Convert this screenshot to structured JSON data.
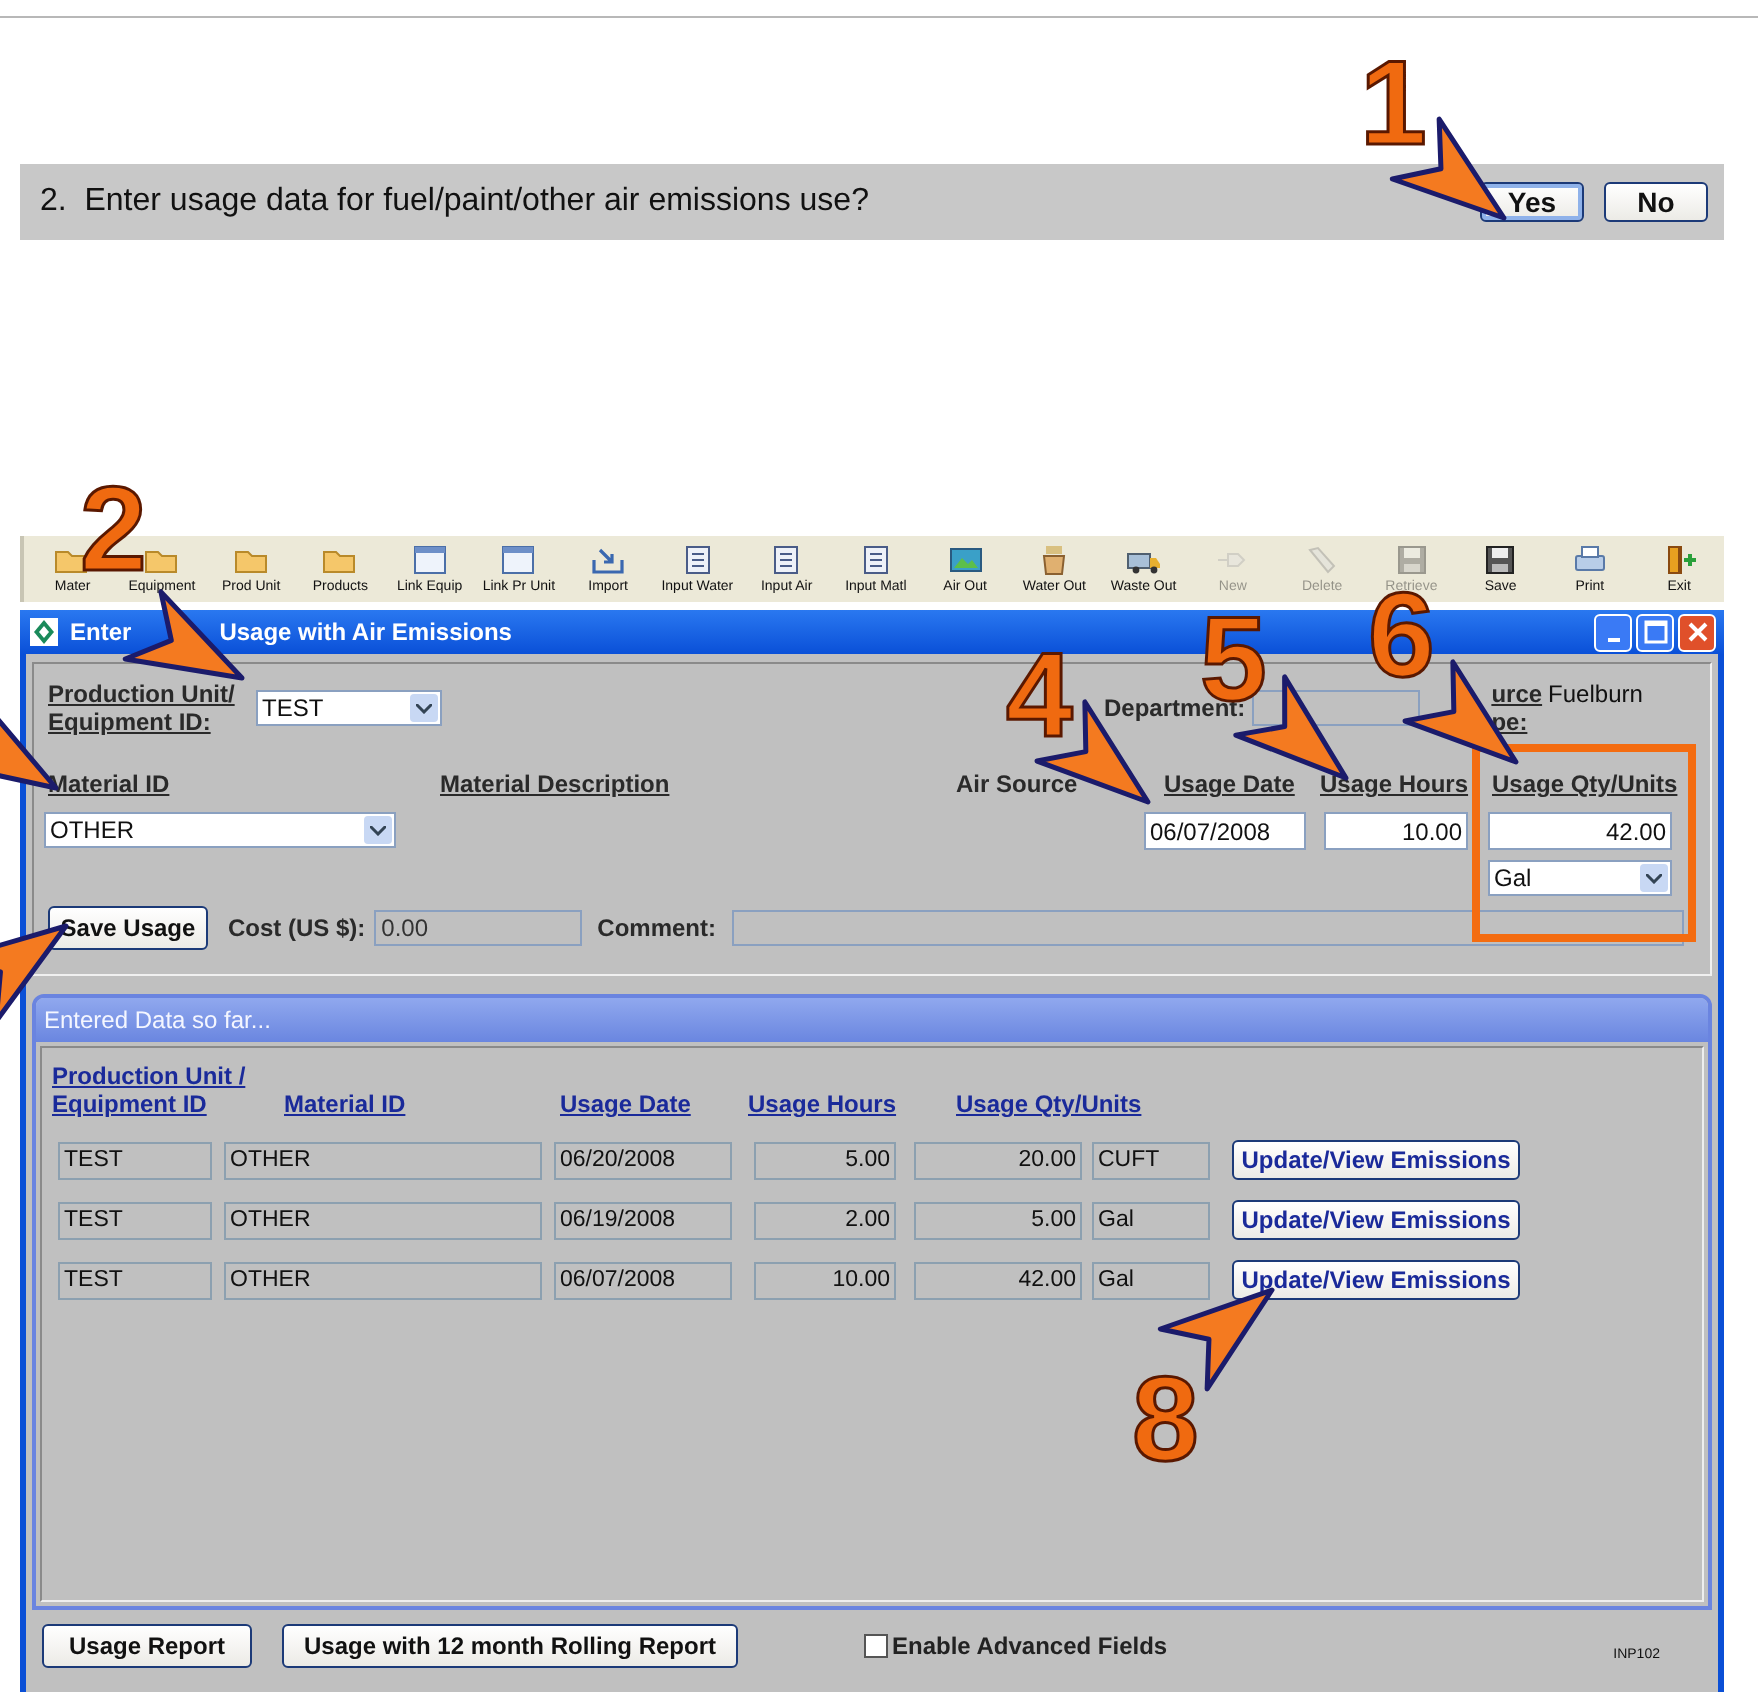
{
  "question": {
    "number": "2.",
    "text": "Enter usage data for fuel/paint/other air emissions use?",
    "buttons": [
      {
        "label": "Yes",
        "selected": true
      },
      {
        "label": "No",
        "selected": false
      }
    ]
  },
  "toolbar": [
    {
      "label": "Mater",
      "kind": "folder",
      "disabled": false
    },
    {
      "label": "Equipment",
      "kind": "folder",
      "disabled": false
    },
    {
      "label": "Prod Unit",
      "kind": "folder",
      "disabled": false
    },
    {
      "label": "Products",
      "kind": "folder",
      "disabled": false
    },
    {
      "label": "Link Equip",
      "kind": "window",
      "disabled": false
    },
    {
      "label": "Link Pr Unit",
      "kind": "window",
      "disabled": false
    },
    {
      "label": "Import",
      "kind": "import",
      "disabled": false
    },
    {
      "label": "Input Water",
      "kind": "document",
      "disabled": false
    },
    {
      "label": "Input Air",
      "kind": "document",
      "disabled": false
    },
    {
      "label": "Input Matl",
      "kind": "document",
      "disabled": false
    },
    {
      "label": "Air Out",
      "kind": "picture",
      "disabled": false
    },
    {
      "label": "Water Out",
      "kind": "bucket",
      "disabled": false
    },
    {
      "label": "Waste Out",
      "kind": "truck",
      "disabled": false
    },
    {
      "label": "New",
      "kind": "plug",
      "disabled": true
    },
    {
      "label": "Delete",
      "kind": "eraser",
      "disabled": true
    },
    {
      "label": "Retrieve",
      "kind": "floppy",
      "disabled": true
    },
    {
      "label": "Save",
      "kind": "floppy",
      "disabled": false
    },
    {
      "label": "Print",
      "kind": "printer",
      "disabled": false
    },
    {
      "label": "Exit",
      "kind": "exit",
      "disabled": false
    }
  ],
  "window": {
    "title_start": "Enter",
    "title_end": "Usage with Air Emissions"
  },
  "form": {
    "equipment_label_lines": [
      "Production Unit/",
      "Equipment ID:"
    ],
    "equipment_value": "TEST",
    "department_label": "Department:",
    "source_label_lines": [
      "urce",
      "pe:"
    ],
    "source_value": "Fuelburn",
    "headers": [
      "Material ID",
      "Material Description",
      "Air Source",
      "Usage Date",
      "Usage Hours",
      "Usage Qty/Units"
    ],
    "material_value": "OTHER",
    "usage_date": "06/07/2008",
    "usage_hours": "10.00",
    "usage_qty": "42.00",
    "unit_value": "Gal",
    "save_button": "Save Usage",
    "cost_label": "Cost (US $):",
    "cost_value": "0.00",
    "comment_label": "Comment:"
  },
  "entered_data": {
    "title": "Entered Data so far...",
    "columns": [
      "Production Unit / Equipment ID",
      "Material ID",
      "Usage Date",
      "Usage Hours",
      "Usage Qty/Units"
    ],
    "rows": [
      {
        "cells": [
          "TEST",
          "OTHER",
          "06/20/2008",
          "5.00",
          "20.00",
          "CUFT"
        ],
        "button": "Update/View Emissions"
      },
      {
        "cells": [
          "TEST",
          "OTHER",
          "06/19/2008",
          "2.00",
          "5.00",
          "Gal"
        ],
        "button": "Update/View Emissions"
      },
      {
        "cells": [
          "TEST",
          "OTHER",
          "06/07/2008",
          "10.00",
          "42.00",
          "Gal"
        ],
        "button": "Update/View Emissions"
      }
    ]
  },
  "footer": {
    "buttons": [
      "Usage Report",
      "Usage with 12 month Rolling Report"
    ],
    "checkbox": {
      "label": "Enable Advanced Fields",
      "checked": false
    },
    "code": "INP102"
  },
  "callouts": [
    {
      "label": "1"
    },
    {
      "label": "2"
    },
    {
      "label": "4"
    },
    {
      "label": "5"
    },
    {
      "label": "6"
    },
    {
      "label": "8"
    }
  ]
}
